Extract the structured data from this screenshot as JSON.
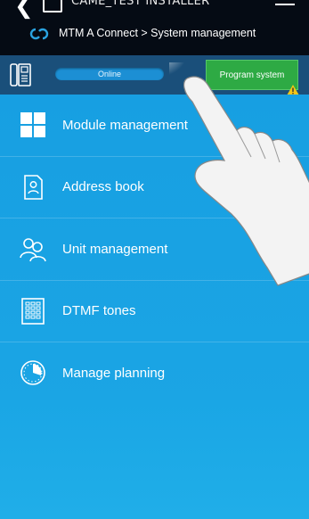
{
  "topbar": {
    "title": "CAME_TEST INSTALLER",
    "back_icon": "back-arrow-icon",
    "home_icon": "home-icon",
    "menu_icon": "hamburger-menu-icon"
  },
  "breadcrumb": {
    "text": "MTM A Connect > System management",
    "icon": "came-connect-icon"
  },
  "status": {
    "device_icon": "intercom-icon",
    "online_label": "Online",
    "program_button": "Program system",
    "warning_icon": "warning-icon",
    "colors": {
      "online": "#1c8fd4",
      "program": "#2eaa44",
      "warning": "#f2c618"
    }
  },
  "menu": {
    "items": [
      {
        "label": "Module management",
        "icon": "modules-grid-icon"
      },
      {
        "label": "Address book",
        "icon": "address-book-icon"
      },
      {
        "label": "Unit management",
        "icon": "users-icon"
      },
      {
        "label": "DTMF tones",
        "icon": "keypad-icon"
      },
      {
        "label": "Manage planning",
        "icon": "clock-planning-icon"
      }
    ]
  },
  "colors": {
    "background": "#1aa3e3",
    "header": "#050b14",
    "status_bar": "#1a4f7a"
  }
}
